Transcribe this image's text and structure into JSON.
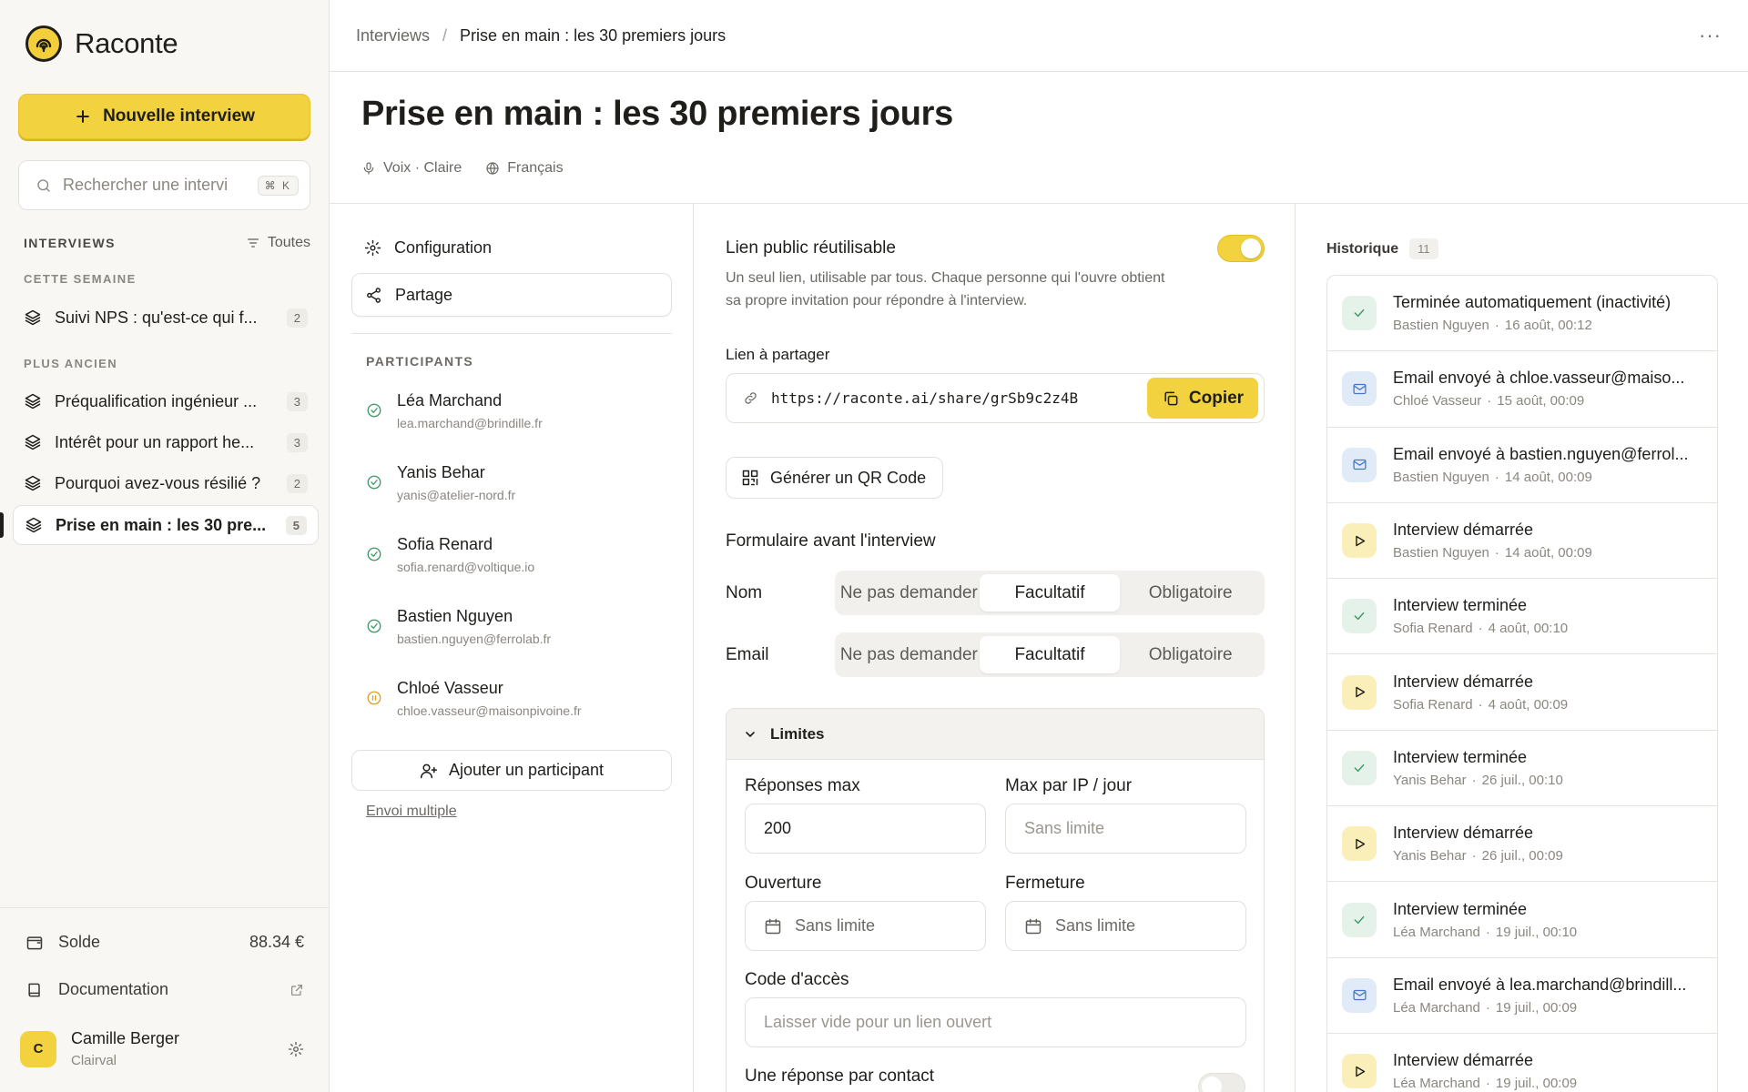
{
  "brand": {
    "name": "Raconte"
  },
  "sidebar": {
    "new_button": "Nouvelle interview",
    "search_placeholder": "Rechercher une intervi",
    "search_kbd": "⌘ K",
    "section_title": "INTERVIEWS",
    "filter_label": "Toutes",
    "group_this_week": "CETTE SEMAINE",
    "group_older": "PLUS ANCIEN",
    "items": [
      {
        "label": "Suivi NPS : qu'est-ce qui f...",
        "count": "2"
      },
      {
        "label": "Préqualification ingénieur ...",
        "count": "3"
      },
      {
        "label": "Intérêt pour un rapport he...",
        "count": "3"
      },
      {
        "label": "Pourquoi avez-vous résilié ?",
        "count": "2"
      },
      {
        "label": "Prise en main : les 30 pre...",
        "count": "5"
      }
    ],
    "balance_label": "Solde",
    "balance_value": "88.34 €",
    "docs_label": "Documentation",
    "user": {
      "initial": "C",
      "name": "Camille Berger",
      "org": "Clairval"
    }
  },
  "topbar": {
    "breadcrumb_root": "Interviews",
    "breadcrumb_sep": "/",
    "breadcrumb_current": "Prise en main : les 30 premiers jours",
    "more": "···"
  },
  "page": {
    "title": "Prise en main : les 30 premiers jours",
    "voice": "Voix · Claire",
    "language": "Français"
  },
  "tabs": {
    "config": "Configuration",
    "share": "Partage"
  },
  "participants": {
    "title": "PARTICIPANTS",
    "list": [
      {
        "name": "Léa Marchand",
        "email": "lea.marchand@brindille.fr",
        "status": "done"
      },
      {
        "name": "Yanis Behar",
        "email": "yanis@atelier-nord.fr",
        "status": "done"
      },
      {
        "name": "Sofia Renard",
        "email": "sofia.renard@voltique.io",
        "status": "done"
      },
      {
        "name": "Bastien Nguyen",
        "email": "bastien.nguyen@ferrolab.fr",
        "status": "done"
      },
      {
        "name": "Chloé Vasseur",
        "email": "chloe.vasseur@maisonpivoine.fr",
        "status": "paused"
      }
    ],
    "add_button": "Ajouter un participant",
    "bulk_link": "Envoi multiple"
  },
  "share": {
    "public_title": "Lien public réutilisable",
    "public_desc": "Un seul lien, utilisable par tous. Chaque personne qui l'ouvre obtient sa propre invitation pour répondre à l'interview.",
    "public_enabled": true,
    "link_label": "Lien à partager",
    "link_url": "https://raconte.ai/share/grSb9c2z4B",
    "copy_button": "Copier",
    "qr_button": "Générer un QR Code",
    "form_title": "Formulaire avant l'interview",
    "form_rows": [
      {
        "label": "Nom",
        "options": [
          "Ne pas demander",
          "Facultatif",
          "Obligatoire"
        ],
        "selected": "Facultatif"
      },
      {
        "label": "Email",
        "options": [
          "Ne pas demander",
          "Facultatif",
          "Obligatoire"
        ],
        "selected": "Facultatif"
      }
    ],
    "limits": {
      "title": "Limites",
      "max_responses_label": "Réponses max",
      "max_responses_value": "200",
      "max_ip_label": "Max par IP / jour",
      "max_ip_placeholder": "Sans limite",
      "open_label": "Ouverture",
      "open_placeholder": "Sans limite",
      "close_label": "Fermeture",
      "close_placeholder": "Sans limite",
      "code_label": "Code d'accès",
      "code_placeholder": "Laisser vide pour un lien ouvert",
      "one_per_contact_label": "Une réponse par contact",
      "one_per_contact_enabled": false
    }
  },
  "history": {
    "title": "Historique",
    "count": "11",
    "events": [
      {
        "kind": "ok",
        "title": "Terminée automatiquement (inactivité)",
        "who": "Bastien Nguyen",
        "when": "16 août, 00:12"
      },
      {
        "kind": "mail",
        "title": "Email envoyé à chloe.vasseur@maiso...",
        "who": "Chloé Vasseur",
        "when": "15 août, 00:09"
      },
      {
        "kind": "mail",
        "title": "Email envoyé à bastien.nguyen@ferrol...",
        "who": "Bastien Nguyen",
        "when": "14 août, 00:09"
      },
      {
        "kind": "play",
        "title": "Interview démarrée",
        "who": "Bastien Nguyen",
        "when": "14 août, 00:09"
      },
      {
        "kind": "ok",
        "title": "Interview terminée",
        "who": "Sofia Renard",
        "when": "4 août, 00:10"
      },
      {
        "kind": "play",
        "title": "Interview démarrée",
        "who": "Sofia Renard",
        "when": "4 août, 00:09"
      },
      {
        "kind": "ok",
        "title": "Interview terminée",
        "who": "Yanis Behar",
        "when": "26 juil., 00:10"
      },
      {
        "kind": "play",
        "title": "Interview démarrée",
        "who": "Yanis Behar",
        "when": "26 juil., 00:09"
      },
      {
        "kind": "ok",
        "title": "Interview terminée",
        "who": "Léa Marchand",
        "when": "19 juil., 00:10"
      },
      {
        "kind": "mail",
        "title": "Email envoyé à lea.marchand@brindill...",
        "who": "Léa Marchand",
        "when": "19 juil., 00:09"
      },
      {
        "kind": "play",
        "title": "Interview démarrée",
        "who": "Léa Marchand",
        "when": "19 juil., 00:09"
      }
    ]
  },
  "colors": {
    "accent": "#f3d23f",
    "success": "#3e9a67",
    "mail": "#4477c9",
    "paused": "#d9a12b"
  }
}
